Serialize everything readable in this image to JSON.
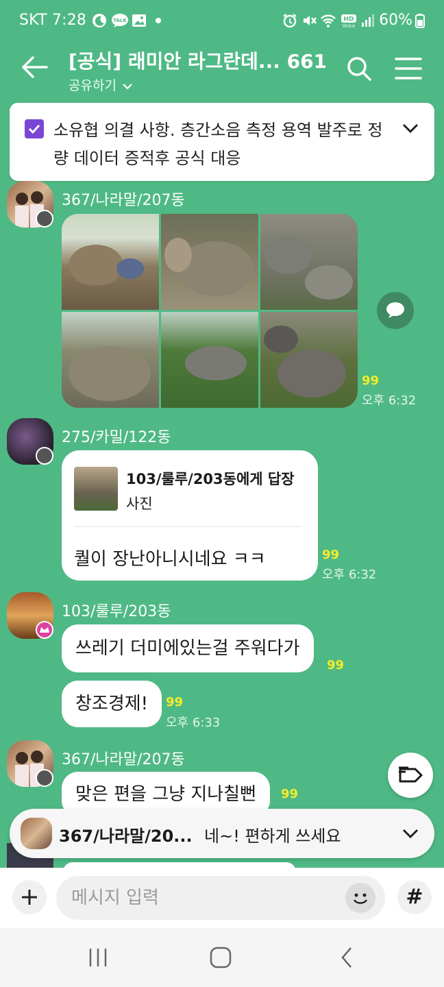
{
  "status_bar": {
    "time": "SKT 7:28",
    "battery": "60%",
    "icons": [
      "moon-icon",
      "talk-icon",
      "image-icon",
      "dot-icon",
      "alarm-icon",
      "mute-icon",
      "wifi-icon",
      "hd-voice-icon",
      "signal-icon",
      "battery-icon"
    ]
  },
  "header": {
    "title": "[공식] 래미안 라그란데... 661",
    "share_label": "공유하기"
  },
  "notice": {
    "text": "소유협 의결 사항. 층간소음 측정 용역 발주로 정량 데이터 증적후 공식 대응"
  },
  "messages": [
    {
      "sender": "367/나라말/207동",
      "unread": "99",
      "time": "오후 6:32",
      "photos": 6
    },
    {
      "sender": "275/카밀/122동",
      "reply_to": "103/룰루/203동에게 답장",
      "reply_sub": "사진",
      "text": "퀄이 장난아니시네요 ㅋㅋ",
      "unread": "99",
      "time": "오후 6:32"
    },
    {
      "sender": "103/룰루/203동",
      "text1": "쓰레기 더미에있는걸 주워다가",
      "unread1": "99",
      "text2": "창조경제!",
      "unread2": "99",
      "time": "오후 6:33"
    },
    {
      "sender": "367/나라말/207동",
      "text": "맞은 편을 그냥 지나칠뻔",
      "unread": "99"
    }
  ],
  "preview": {
    "sender": "367/나라말/20...",
    "text": "네~! 편하게 쓰세요"
  },
  "input": {
    "placeholder": "메시지 입력",
    "hash": "#"
  },
  "colors": {
    "background": "#4fb985",
    "unread": "#f5ec2b",
    "notice_check": "#7b46d6",
    "bubble": "#ffffff"
  }
}
